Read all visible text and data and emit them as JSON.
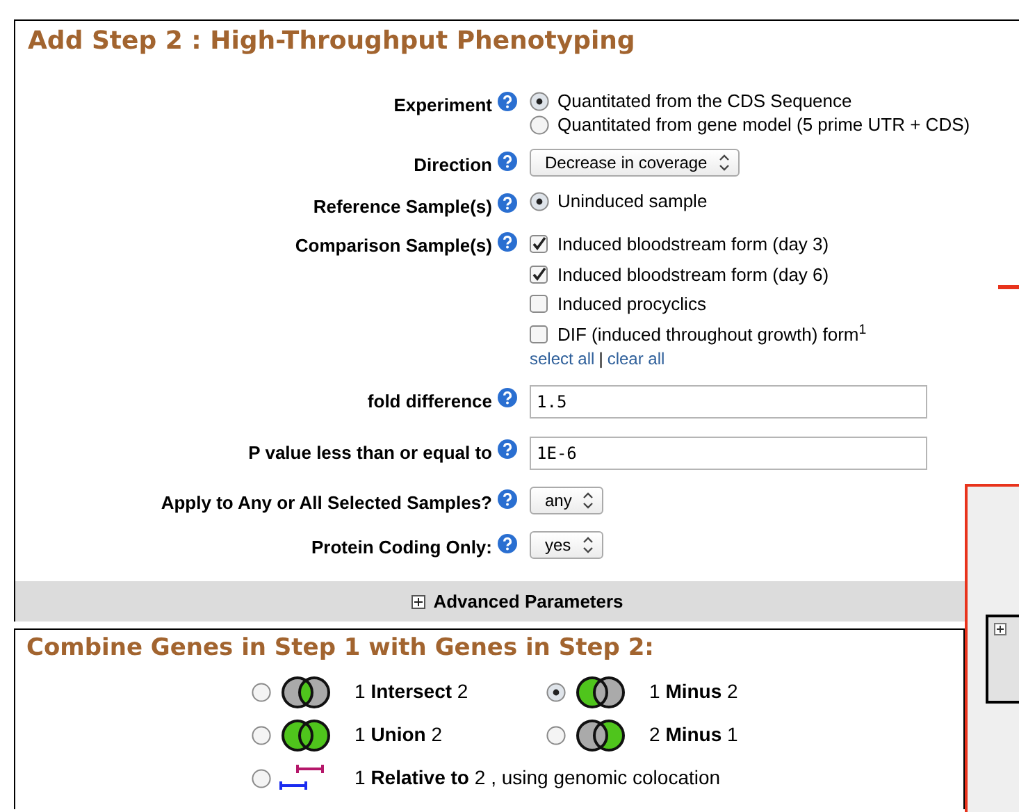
{
  "title": "Add Step 2 : High-Throughput Phenotyping",
  "params": [
    {
      "label": "Experiment",
      "kind": "radio",
      "options": [
        {
          "label": "Quantitated from the CDS Sequence",
          "selected": true
        },
        {
          "label": "Quantitated from gene model (5 prime UTR + CDS)",
          "selected": false
        }
      ]
    },
    {
      "label": "Direction",
      "kind": "select",
      "value": "Decrease in coverage"
    },
    {
      "label": "Reference Sample(s)",
      "kind": "radio",
      "options": [
        {
          "label": "Uninduced sample",
          "selected": true
        }
      ]
    },
    {
      "label": "Comparison Sample(s)",
      "kind": "checkbox",
      "options": [
        {
          "label": "Induced bloodstream form (day 3)",
          "checked": true
        },
        {
          "label": "Induced bloodstream form (day 6)",
          "checked": true
        },
        {
          "label": "Induced procyclics",
          "checked": false
        },
        {
          "label": "DIF (induced throughout growth) form$^{1}$",
          "checked": false
        }
      ],
      "links": [
        "select all",
        "clear all"
      ],
      "link_separator": "|"
    },
    {
      "label": "fold difference",
      "kind": "text",
      "value": "1.5"
    },
    {
      "label": "P value less than or equal to",
      "kind": "text",
      "value": "1E-6"
    },
    {
      "label": "Apply to Any or All Selected Samples?",
      "kind": "select",
      "value": "any"
    },
    {
      "label": "Protein Coding Only:",
      "kind": "select",
      "value": "yes"
    }
  ],
  "advanced": {
    "label": "Advanced Parameters",
    "expanded": false
  },
  "combine": {
    "title": "Combine Genes in Step 1 with Genes in Step 2:",
    "operations": [
      {
        "kind": "intersect",
        "label": "1 **Intersect** 2",
        "selected": false
      },
      {
        "kind": "minus",
        "label": "1 **Minus** 2",
        "selected": true
      },
      {
        "kind": "union",
        "label": "1 **Union** 2",
        "selected": false
      },
      {
        "kind": "minus_reverse",
        "label": "2 **Minus** 1",
        "selected": false
      },
      {
        "kind": "relative",
        "label": "1 **Relative to** 2 , using genomic colocation",
        "selected": false
      }
    ]
  }
}
